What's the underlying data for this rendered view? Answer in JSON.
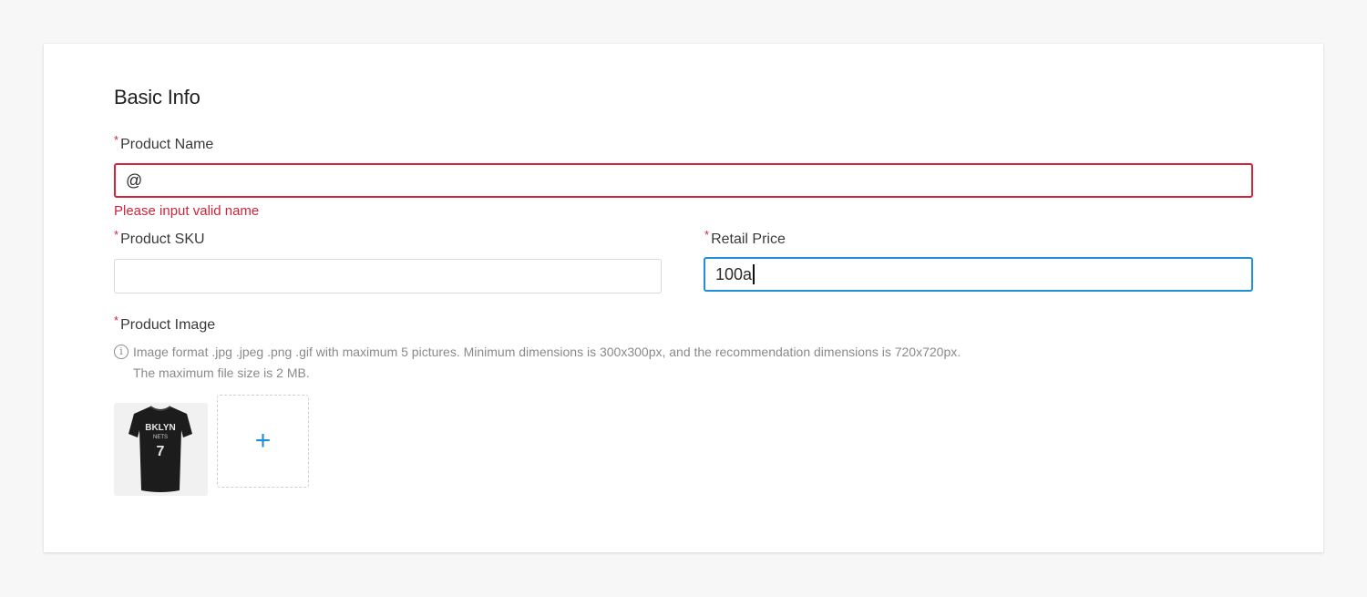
{
  "section": {
    "title": "Basic Info"
  },
  "fields": {
    "product_name": {
      "label": "Product Name",
      "required_mark": "*",
      "value": "@",
      "error": "Please input valid name"
    },
    "product_sku": {
      "label": "Product SKU",
      "required_mark": "*",
      "value": ""
    },
    "retail_price": {
      "label": "Retail Price",
      "required_mark": "*",
      "value": "100a"
    },
    "product_image": {
      "label": "Product Image",
      "required_mark": "*",
      "hint_icon": "info-icon",
      "hint_line1": "Image format .jpg .jpeg .png .gif with maximum 5 pictures. Minimum dimensions is 300x300px, and the recommendation dimensions is 720x720px.",
      "hint_line2": "The maximum file size is 2 MB.",
      "tshirt_text_1": "BKLYN",
      "tshirt_text_2": "NETS",
      "tshirt_number": "7",
      "upload_symbol": "+"
    }
  },
  "colors": {
    "error": "#d0253b",
    "focus": "#1e8fd8",
    "accent": "#1e8fd8"
  }
}
